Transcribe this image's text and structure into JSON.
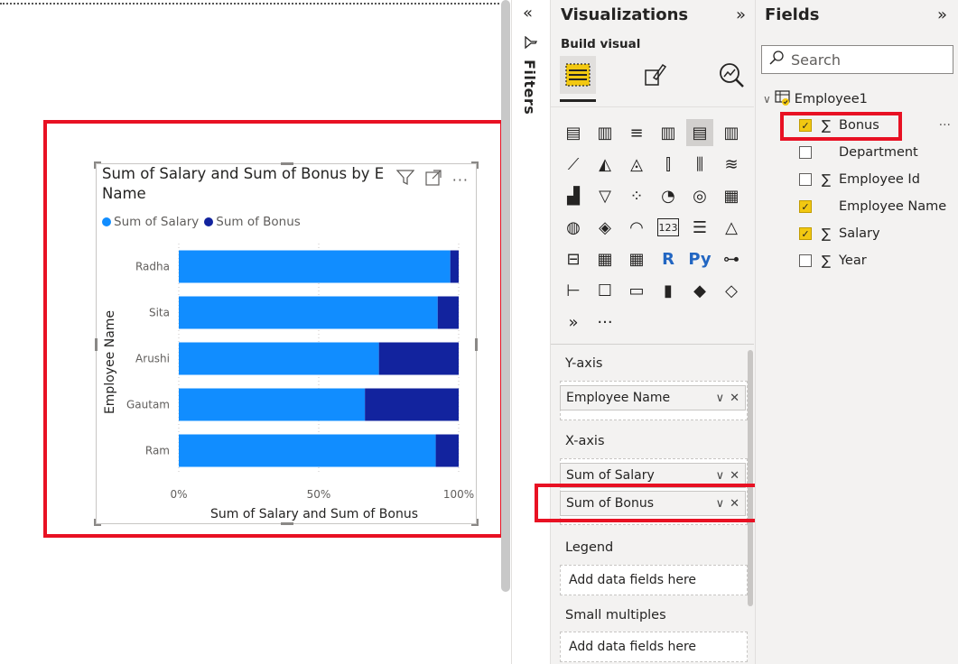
{
  "chart_data": {
    "type": "bar",
    "orientation": "horizontal",
    "stacking": "percent",
    "title": "Sum of Salary and Sum of Bonus by E",
    "title_line2": "Name",
    "xlabel": "Sum of Salary and Sum of Bonus",
    "ylabel": "Employee Name",
    "categories": [
      "Radha",
      "Sita",
      "Arushi",
      "Gautam",
      "Ram"
    ],
    "series": [
      {
        "name": "Sum of Salary",
        "values": [
          0.97,
          0.925,
          0.715,
          0.665,
          0.918
        ],
        "color": "#118dff"
      },
      {
        "name": "Sum of Bonus",
        "values": [
          0.03,
          0.075,
          0.285,
          0.335,
          0.082
        ],
        "color": "#12239e"
      }
    ],
    "xticks": [
      "0%",
      "50%",
      "100%"
    ],
    "xlim": [
      0,
      1
    ],
    "grid": true,
    "legend_position": "top-left"
  },
  "filters": {
    "collapse_icon": "chevrons-left-icon",
    "label": "Filters"
  },
  "viz": {
    "header": "Visualizations",
    "build_label": "Build visual",
    "wells": {
      "yaxis_title": "Y-axis",
      "yaxis_field": "Employee Name",
      "xaxis_title": "X-axis",
      "xaxis_field1": "Sum of Salary",
      "xaxis_field2": "Sum of Bonus",
      "legend_title": "Legend",
      "legend_placeholder": "Add data fields here",
      "small_title": "Small multiples",
      "small_placeholder": "Add data fields here"
    }
  },
  "fields": {
    "header": "Fields",
    "search_placeholder": "Search",
    "table_name": "Employee1",
    "items": [
      {
        "label": "Bonus",
        "checked": true,
        "sigma": true
      },
      {
        "label": "Department",
        "checked": false,
        "sigma": false
      },
      {
        "label": "Employee Id",
        "checked": false,
        "sigma": true
      },
      {
        "label": "Employee Name",
        "checked": true,
        "sigma": false
      },
      {
        "label": "Salary",
        "checked": true,
        "sigma": true
      },
      {
        "label": "Year",
        "checked": false,
        "sigma": true
      }
    ],
    "more": "···"
  },
  "colors": {
    "highlight": "#e81123",
    "accent": "#f2c811"
  }
}
